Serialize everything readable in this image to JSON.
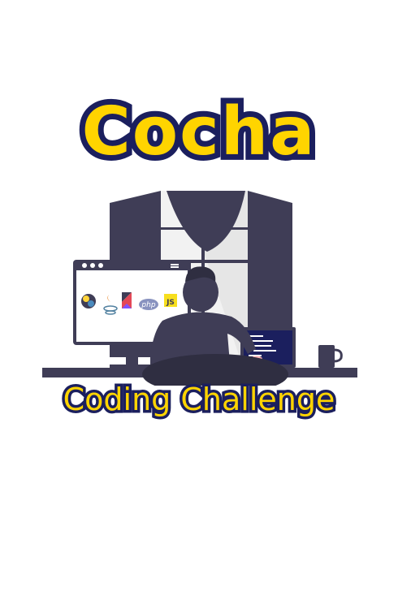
{
  "logo": {
    "title": "Cocha",
    "subtitle": "Coding Challenge",
    "icons": {
      "python": "python-logo-icon",
      "java": "java-logo-icon",
      "kotlin": "kotlin-logo-icon",
      "php": "php",
      "js": "JS"
    },
    "colors": {
      "title_fill": "#ffd400",
      "title_outline": "#1b1f5e",
      "illustration_dark": "#3f3d56"
    }
  }
}
